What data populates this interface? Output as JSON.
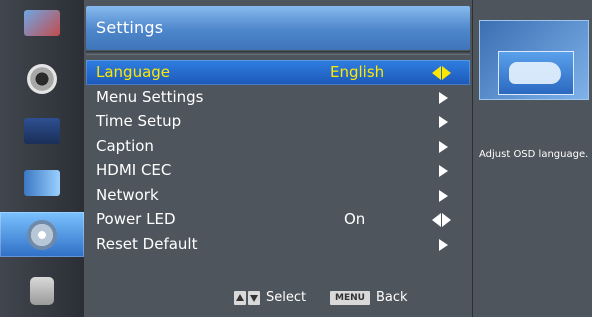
{
  "header": {
    "title": "Settings"
  },
  "menu": {
    "items": [
      {
        "label": "Language",
        "value": "English",
        "control": "lr",
        "selected": true
      },
      {
        "label": "Menu Settings",
        "value": "",
        "control": "right"
      },
      {
        "label": "Time Setup",
        "value": "",
        "control": "right"
      },
      {
        "label": "Caption",
        "value": "",
        "control": "right"
      },
      {
        "label": "HDMI CEC",
        "value": "",
        "control": "right"
      },
      {
        "label": "Network",
        "value": "",
        "control": "right"
      },
      {
        "label": "Power LED",
        "value": "On",
        "control": "lr"
      },
      {
        "label": "Reset Default",
        "value": "",
        "control": "right"
      }
    ]
  },
  "footer": {
    "select_label": "Select",
    "menu_key": "MENU",
    "back_label": "Back"
  },
  "side": {
    "help": "Adjust OSD language."
  },
  "rail": {
    "icons": [
      "picture-icon",
      "audio-icon",
      "display-icon",
      "channel-icon",
      "settings-gear-icon",
      "lock-icon"
    ],
    "active_index": 4
  },
  "colors": {
    "accent_blue": "#2f7fe1",
    "highlight_text": "#ffe800"
  }
}
